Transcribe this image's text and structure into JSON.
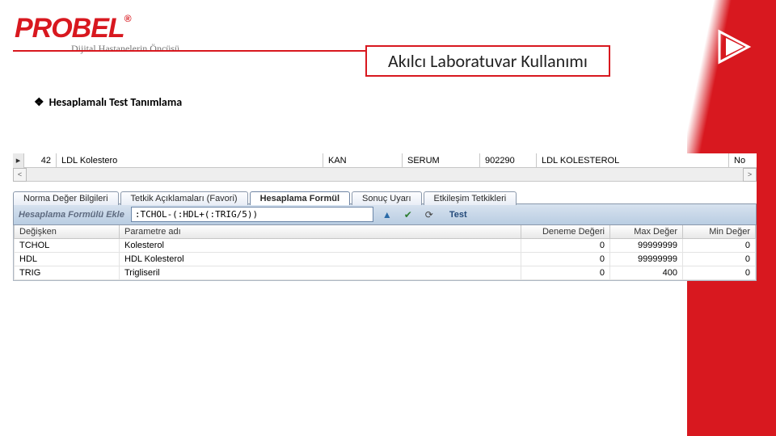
{
  "brand": {
    "name": "PROBEL",
    "registered": "®",
    "tagline": "Dijital Hastanelerin Öncüsü"
  },
  "slide": {
    "title": "Akılcı Laboratuvar Kullanımı",
    "bullet_glyph": "❖",
    "bullet_text": "Hesaplamalı Test Tanımlama"
  },
  "record": {
    "gutter": "▸",
    "id": "42",
    "name": "LDL Kolestero",
    "material": "KAN",
    "specimen": "SERUM",
    "code": "902290",
    "group": "LDL KOLESTEROL",
    "last": "No"
  },
  "tabs": [
    {
      "label": "Norma Değer Bilgileri"
    },
    {
      "label": "Tetkik Açıklamaları (Favori)"
    },
    {
      "label": "Hesaplama Formül"
    },
    {
      "label": "Sonuç Uyarı"
    },
    {
      "label": "Etkileşim Tetkikleri"
    }
  ],
  "formula": {
    "label": "Hesaplama Formülü Ekle",
    "value": ":TCHOL-(:HDL+(:TRIG/5))",
    "test_label": "Test"
  },
  "vars_headers": {
    "var": "Değişken",
    "param": "Parametre adı",
    "trial": "Deneme Değeri",
    "max": "Max Değer",
    "min": "Min Değer"
  },
  "vars_rows": [
    {
      "var": "TCHOL",
      "param": "Kolesterol",
      "trial": "0",
      "max": "99999999",
      "min": "0"
    },
    {
      "var": "HDL",
      "param": "HDL Kolesterol",
      "trial": "0",
      "max": "99999999",
      "min": "0"
    },
    {
      "var": "TRIG",
      "param": "Trigliseril",
      "trial": "0",
      "max": "400",
      "min": "0"
    }
  ]
}
